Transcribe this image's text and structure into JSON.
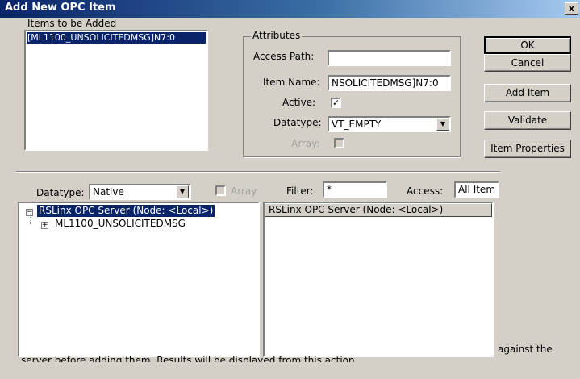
{
  "window": {
    "title": "Add New OPC Item",
    "close_glyph": "x"
  },
  "items_to_add": {
    "label": "Items to be Added",
    "items": [
      "[ML1100_UNSOLICITEDMSG]N7:0"
    ]
  },
  "attributes": {
    "group_title": "Attributes",
    "access_path_label": "Access Path:",
    "access_path_value": "",
    "item_name_label": "Item Name:",
    "item_name_value": "NSOLICITEDMSG]N7:0",
    "active_label": "Active:",
    "active_checked": true,
    "datatype_label": "Datatype:",
    "datatype_value": "VT_EMPTY",
    "array_label": "Array:",
    "array_checked": false
  },
  "buttons": {
    "ok": "OK",
    "cancel": "Cancel",
    "add_item": "Add Item",
    "validate": "Validate",
    "item_properties": "Item Properties"
  },
  "browser": {
    "datatype_label": "Datatype:",
    "datatype_value": "Native",
    "array_label": "Array",
    "filter_label": "Filter:",
    "filter_value": "*",
    "access_label": "Access:",
    "access_value": "All Item",
    "tree": {
      "root": "RSLinx OPC Server (Node: <Local>)",
      "children": [
        "ML1100_UNSOLICITEDMSG"
      ]
    },
    "list_header": "RSLinx OPC Server (Node: <Local>)"
  },
  "hint": {
    "line1_tail": "against the",
    "line2": "server before adding them.  Results will be displayed from this action."
  },
  "icons": {
    "checkmark": "✓",
    "dropdown": "▼",
    "minus": "−",
    "plus": "+"
  }
}
